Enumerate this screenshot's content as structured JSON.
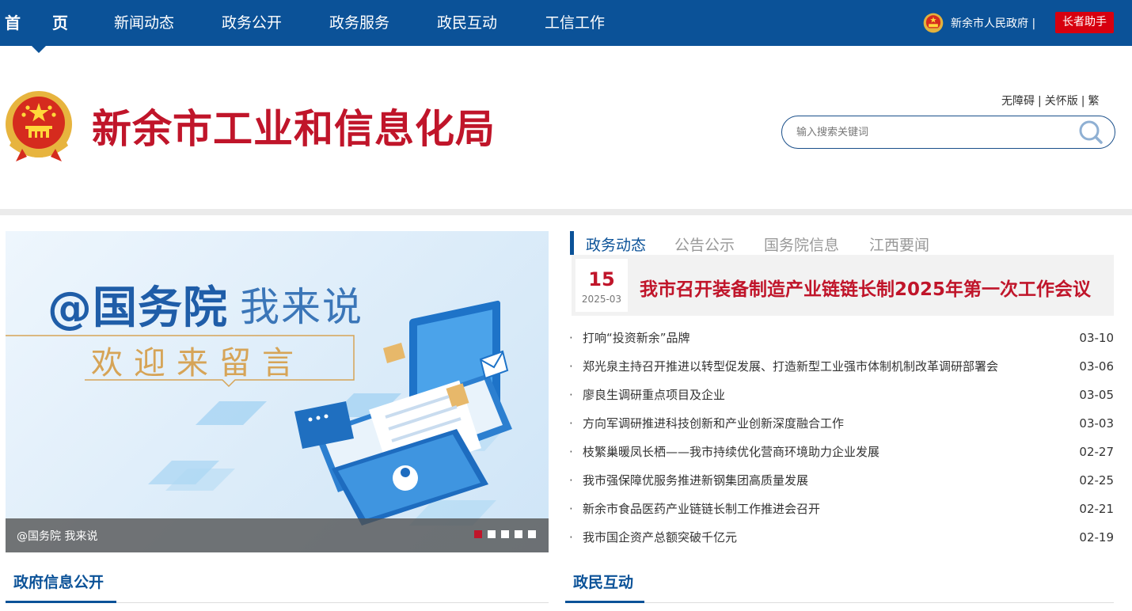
{
  "nav": {
    "home": "首页",
    "items": [
      "新闻动态",
      "政务公开",
      "政务服务",
      "政民互动",
      "工信工作"
    ],
    "gov_link": "新余市人民政府 |",
    "elder_button": "长者助手"
  },
  "header": {
    "site_title": "新余市工业和信息化局",
    "tools": [
      "无障碍",
      "关怀版",
      "繁"
    ],
    "search_placeholder": "输入搜索关键词"
  },
  "banner": {
    "title_main": "@国务院",
    "title_side": "我来说",
    "subtitle": "欢迎来留言",
    "caption": "@国务院 我来说",
    "slides": 5,
    "active_slide": 1
  },
  "news": {
    "tabs": [
      "政务动态",
      "公告公示",
      "国务院信息",
      "江西要闻"
    ],
    "active_tab": 0,
    "headline": {
      "day": "15",
      "year_month": "2025-03",
      "title": "我市召开装备制造产业链链长制2025年第一次工作会议"
    },
    "items": [
      {
        "title": "打响“投资新余”品牌",
        "date": "03-10"
      },
      {
        "title": "郑光泉主持召开推进以转型促发展、打造新型工业强市体制机制改革调研部署会",
        "date": "03-06"
      },
      {
        "title": "廖良生调研重点项目及企业",
        "date": "03-05"
      },
      {
        "title": "方向军调研推进科技创新和产业创新深度融合工作",
        "date": "03-03"
      },
      {
        "title": "枝繁巢暖凤长栖——我市持续优化营商环境助力企业发展",
        "date": "02-27"
      },
      {
        "title": "我市强保障优服务推进新钢集团高质量发展",
        "date": "02-25"
      },
      {
        "title": "新余市食品医药产业链链长制工作推进会召开",
        "date": "02-21"
      },
      {
        "title": "我市国企资产总额突破千亿元",
        "date": "02-19"
      }
    ]
  },
  "sections": {
    "gov_info": "政府信息公开",
    "interaction": "政民互动"
  },
  "colors": {
    "nav_blue": "#0b5298",
    "title_red": "#c0152a",
    "elder_red": "#d7000f"
  }
}
